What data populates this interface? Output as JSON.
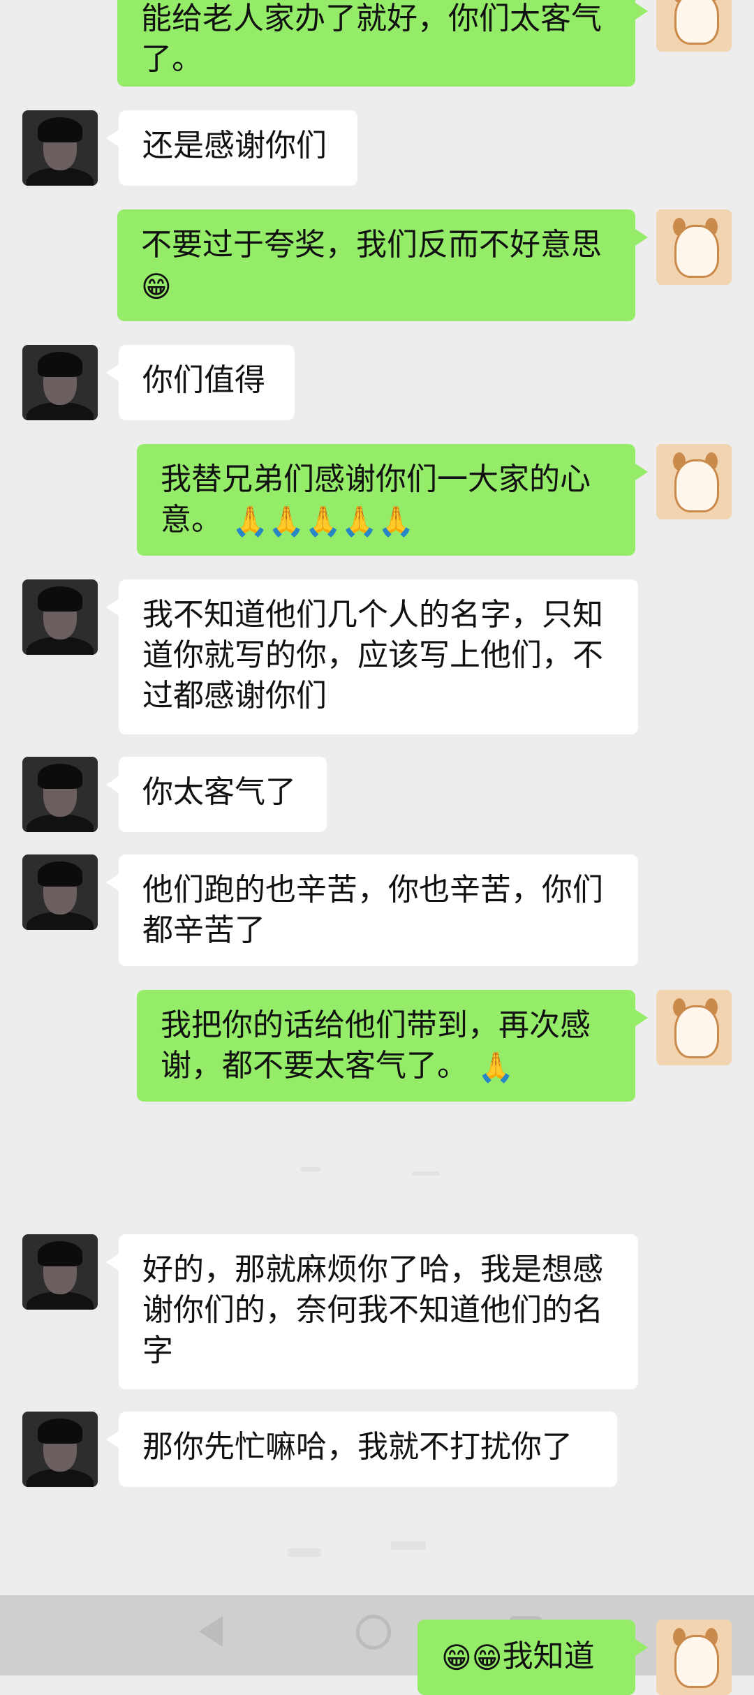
{
  "messages": [
    {
      "side": "out",
      "text": "能给老人家办了就好，你们太客气了。"
    },
    {
      "side": "in",
      "text": "还是感谢你们"
    },
    {
      "side": "out",
      "text": "不要过于夸奖，我们反而不好意思",
      "emoji": "😁"
    },
    {
      "side": "in",
      "text": "你们值得"
    },
    {
      "side": "out",
      "text": "我替兄弟们感谢你们一大家的心意。",
      "emoji": "🙏🙏🙏🙏🙏"
    },
    {
      "side": "in",
      "text": "我不知道他们几个人的名字，只知道你就写的你，应该写上他们，不过都感谢你们"
    },
    {
      "side": "in",
      "text": "你太客气了"
    },
    {
      "side": "in",
      "text": "他们跑的也辛苦，你也辛苦，你们都辛苦了"
    },
    {
      "side": "out",
      "text": "我把你的话给他们带到，再次感谢，都不要太客气了。",
      "emoji": "🙏"
    },
    {
      "side": "in",
      "text": "好的，那就麻烦你了哈，我是想感谢你们的，奈何我不知道他们的名字"
    },
    {
      "side": "in",
      "text": "那你先忙嘛哈，我就不打扰你了"
    },
    {
      "side": "out",
      "text": "我知道",
      "emoji_prefix": "😁😁"
    }
  ],
  "icons": {
    "nav_back": "back-triangle-icon",
    "nav_home": "home-circle-icon",
    "nav_recent": "recent-square-icon"
  }
}
